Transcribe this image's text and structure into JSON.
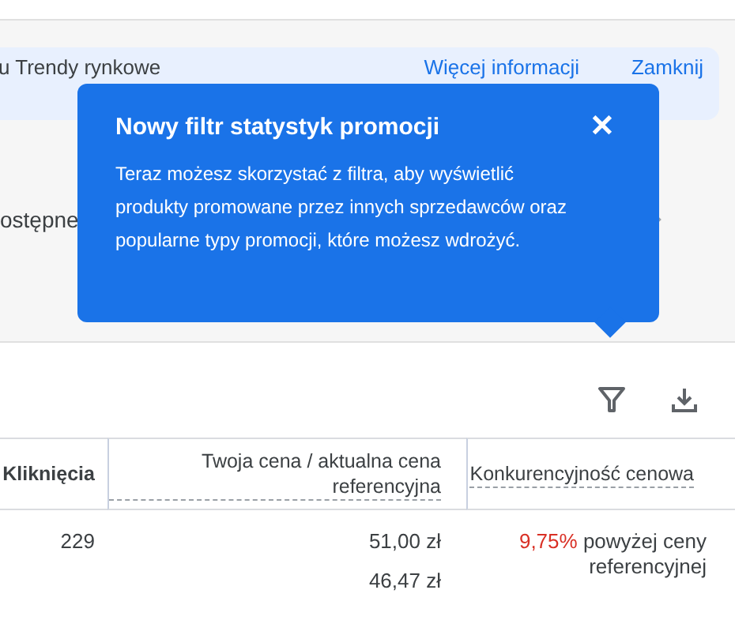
{
  "banner": {
    "text": "u Trendy rynkowe",
    "links": [
      "Więcej informacji",
      "Zamknij"
    ]
  },
  "row_label": "ostępne",
  "popup": {
    "title": "Nowy filtr statystyk promocji",
    "close": "✕",
    "body": "Teraz możesz skorzystać z filtra, aby wyświetlić produkty promowane przez innych sprzedawców oraz popularne typy promocji, które możesz wdrożyć."
  },
  "table": {
    "columns": [
      "Kliknięcia",
      "Twoja cena / aktualna cena referencyjna",
      "Konkurencyjność cenowa"
    ],
    "rows": [
      {
        "clicks": "229",
        "prices": [
          "51,00 zł",
          "46,47 zł"
        ],
        "competitiveness": {
          "percent": "9,75%",
          "text": "powyżej ceny referencyjnej"
        }
      }
    ]
  }
}
